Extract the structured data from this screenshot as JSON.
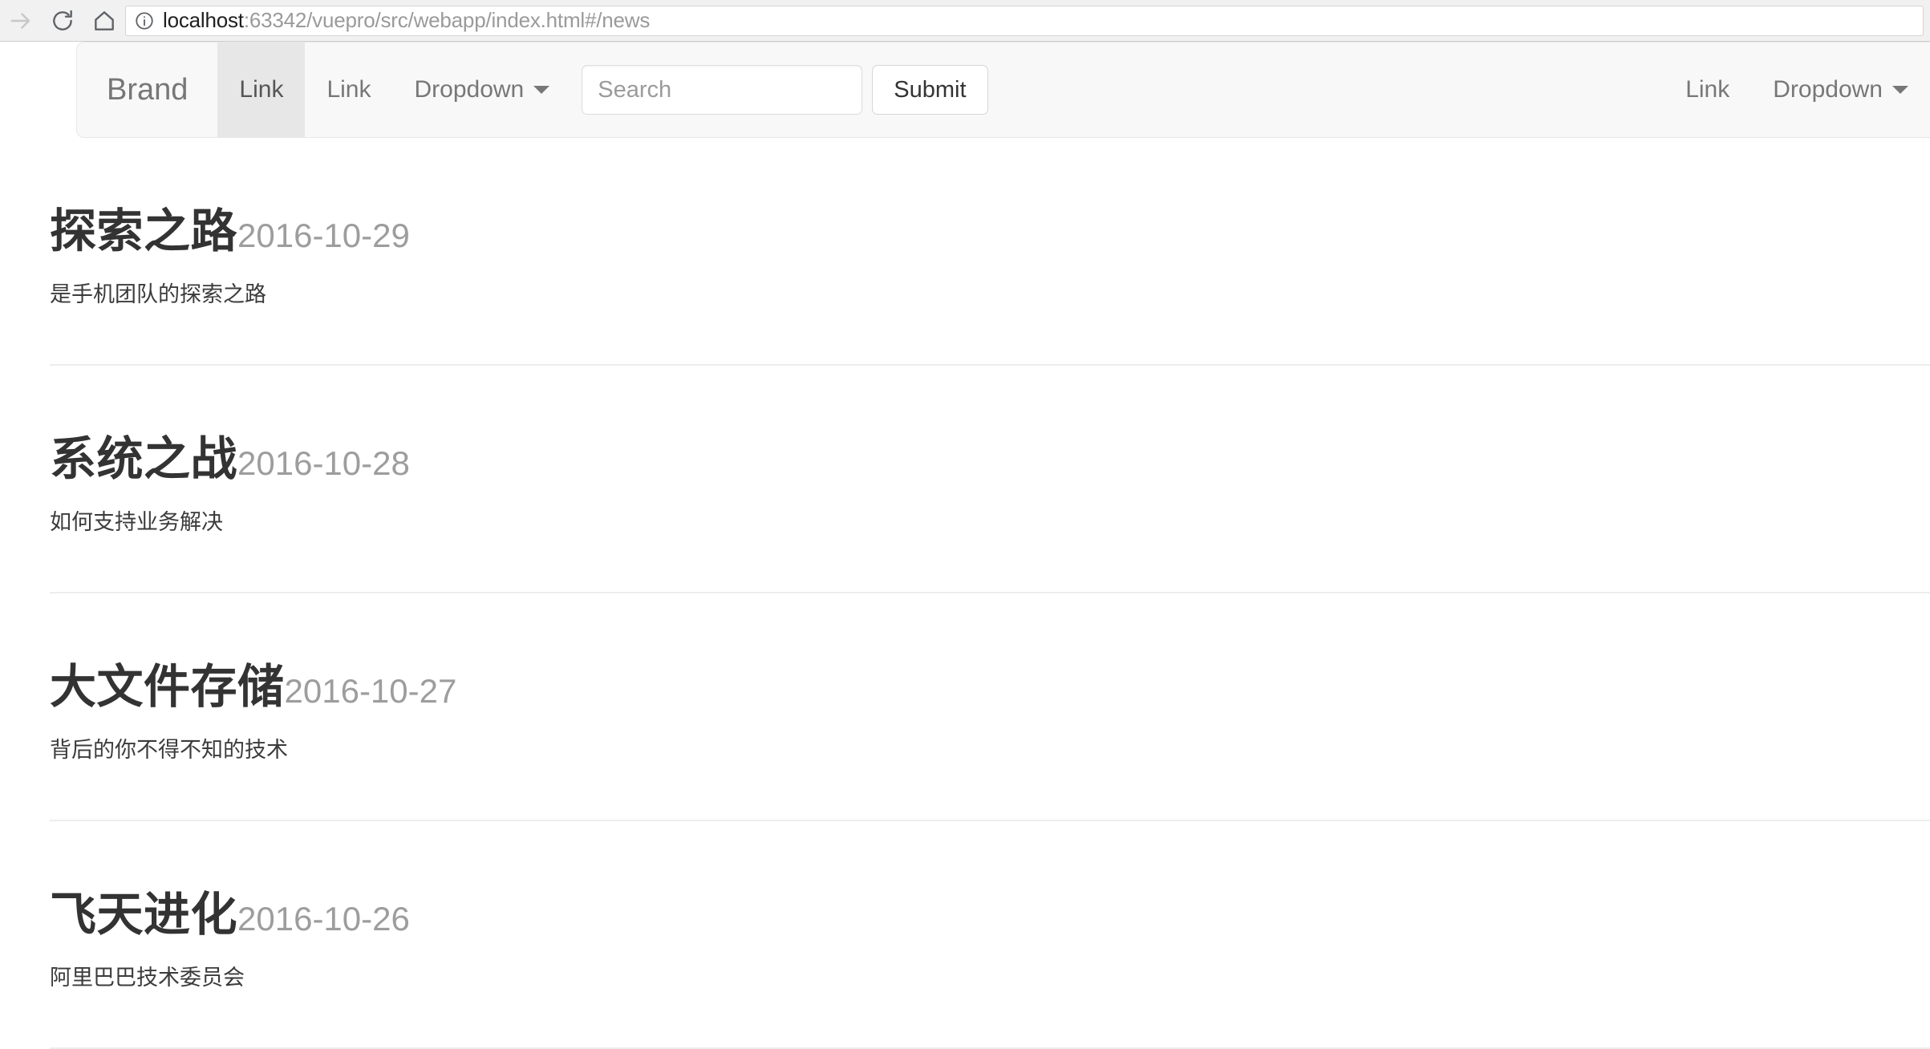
{
  "browser": {
    "toolbar": {
      "forward_icon": "forward-arrow-icon",
      "reload_icon": "reload-icon",
      "home_icon": "home-icon"
    },
    "omnibox": {
      "info_icon": "page-info-icon",
      "url_host": "localhost",
      "url_rest": ":63342/vuepro/src/webapp/index.html#/news",
      "url_full": "localhost:63342/vuepro/src/webapp/index.html#/news"
    }
  },
  "navbar": {
    "brand": "Brand",
    "left_items": [
      {
        "label": "Link",
        "active": true,
        "caret": false
      },
      {
        "label": "Link",
        "active": false,
        "caret": false
      },
      {
        "label": "Dropdown",
        "active": false,
        "caret": true
      }
    ],
    "search": {
      "placeholder": "Search",
      "value": "",
      "submit_label": "Submit"
    },
    "right_items": [
      {
        "label": "Link",
        "active": false,
        "caret": false
      },
      {
        "label": "Dropdown",
        "active": false,
        "caret": true
      }
    ],
    "colors": {
      "background": "#f8f8f8",
      "border": "#e7e7e7",
      "active_background": "#e7e7e7",
      "link_text": "#777777"
    }
  },
  "news": {
    "items": [
      {
        "title": "探索之路",
        "date": "2016-10-29",
        "description": "是手机团队的探索之路"
      },
      {
        "title": "系统之战",
        "date": "2016-10-28",
        "description": "如何支持业务解决"
      },
      {
        "title": "大文件存储",
        "date": "2016-10-27",
        "description": "背后的你不得不知的技术"
      },
      {
        "title": "飞天进化",
        "date": "2016-10-26",
        "description": "阿里巴巴技术委员会"
      }
    ]
  }
}
